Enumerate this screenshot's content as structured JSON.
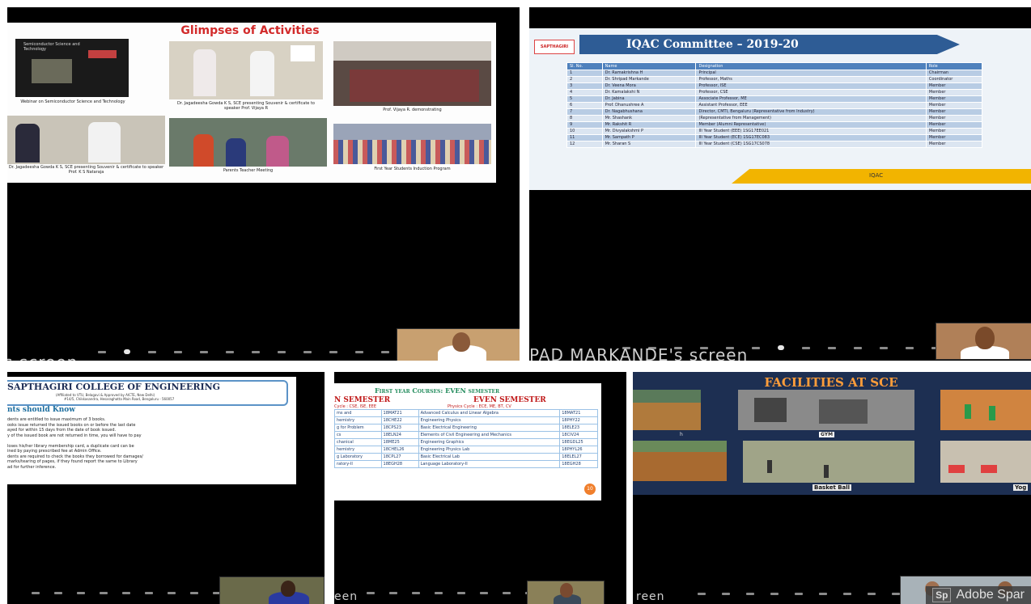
{
  "tiles": {
    "activities": {
      "title": "Glimpses of Activities",
      "title_color": "#d22a2a",
      "photos": [
        {
          "caption": "Webinar on Semiconductor Science and Technology"
        },
        {
          "caption": "Dr. Jagadeesha Gowda K S, SCE presenting Souvenir & certificate to speaker Prof. Vijaya R"
        },
        {
          "caption": "Prof. Vijaya R. demonstrating"
        },
        {
          "caption": "Dr. Jagadeesha Gowda K S, SCE presenting Souvenir & certificate to speaker Prof. K S Nataraja"
        },
        {
          "caption": "Parents Teacher Meeting"
        },
        {
          "caption": "First Year Students Induction Program"
        }
      ],
      "inner_title": "Semiconductor Science and Technology"
    },
    "iqac": {
      "title": "IQAC Committee – 2019-20",
      "logo_text": "SAPTHAGIRI",
      "headers": [
        "Sl. No.",
        "Name",
        "Designation",
        "Role"
      ],
      "rows": [
        [
          "1",
          "Dr. Ramakrishna H",
          "Principal",
          "Chairman"
        ],
        [
          "2",
          "Dr. Shripad Markande",
          "Professor, Maths",
          "Coordinator"
        ],
        [
          "3",
          "Dr. Veena Mora",
          "Professor, ISE",
          "Member"
        ],
        [
          "4",
          "Dr. Kamalakshi N",
          "Professor, CSE",
          "Member"
        ],
        [
          "5",
          "Dr. Jabina",
          "Associate Professor, ME",
          "Member"
        ],
        [
          "6",
          "Prof. Dhanushree A",
          "Assistant Professor, EEE",
          "Member"
        ],
        [
          "7",
          "Dr. Nagabhushana",
          "Director, CMTI, Bengaluru (Representative from Industry)",
          "Member"
        ],
        [
          "8",
          "Mr. Shashank",
          "(Representative from Management)",
          "Member"
        ],
        [
          "9",
          "Mr. Rakshit R",
          "Member (Alumni Representative)",
          "Member"
        ],
        [
          "10",
          "Mr. Divyalakshmi P",
          "III Year Student (EEE) 1SG17EE021",
          "Member"
        ],
        [
          "11",
          "Mr. Sampath P",
          "III Year Student (ECE) 1SG17EC083",
          "Member"
        ],
        [
          "12",
          "Mr. Sharan S",
          "III Year Student (CSE) 1SG17CS078",
          "Member"
        ]
      ],
      "footer": "IQAC",
      "screen_caption": "PAD MARKANDE's screen"
    },
    "library": {
      "college": "SAPTHAGIRI COLLEGE OF ENGINEERING",
      "college_sub": "(Affiliated to VTU, Belagavi & Approved by AICTE, New Delhi)",
      "college_addr": "#14/5, Chikkasandra, Hesaraghatta Main Road, Bengaluru - 560057",
      "heading": "nts should Know",
      "lines": [
        "dents are entitled to issue maximum of 3 books.",
        "ooks issue returned the issued books on or before the last date",
        "ayed for within 15 days from the date of book issued.",
        "y of the issued book are not returned in time, you will have to pay",
        "",
        "loses his/her library membership card, a duplicate card can be",
        "ined by paying prescribed fee at Admin Office.",
        "dents are required to check the books they borrowed for damages/",
        "marks/tearing of pages, if they found report the same to Library",
        "ad for further inference."
      ],
      "screen_caption": "een"
    },
    "courses": {
      "title": "First year Courses: EVEN semester",
      "left_head": "N SEMESTER",
      "left_sub": "Cycle : CSE, ISE, EEE",
      "right_head": "EVEN SEMESTER",
      "right_sub": "Physics Cycle : ECE, ME, BT, CV",
      "rows": [
        [
          "ms and",
          "18MAT21",
          "Advanced Calculus and Linear Algebra",
          "18MAT21"
        ],
        [
          "hemistry",
          "18CHE22",
          "Engineering Physics",
          "18PHY22"
        ],
        [
          "g for Problem",
          "18CPS23",
          "Basic Electrical Engineering",
          "18ELE23"
        ],
        [
          "cs",
          "18ELN24",
          "Elements of Civil Engineering and Mechanics",
          "18CIV24"
        ],
        [
          "chanical",
          "18ME25",
          "Engineering Graphics",
          "18EGDL25"
        ],
        [
          "hemistry",
          "18CHEL26",
          "Engineering Physics Lab",
          "18PHYL26"
        ],
        [
          "g Laboratory",
          "18CPL27",
          "Basic Electrical Lab",
          "18ELEL27"
        ],
        [
          "ratory-II",
          "18EGH28",
          "Language Laboratory-II",
          "18EGH28"
        ]
      ],
      "page_badge": "10",
      "screen_caption": "een"
    },
    "facilities": {
      "title": "FACILITIES AT SCE",
      "labels": [
        "GYM",
        "Basket Ball",
        "Yog"
      ],
      "side_label": "h",
      "screen_caption": "reen",
      "watermark_logo": "Sp",
      "watermark": "Adobe Spar"
    },
    "blank_caption": "s screen"
  }
}
